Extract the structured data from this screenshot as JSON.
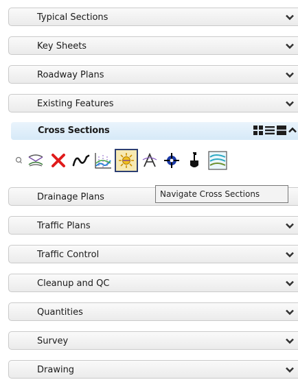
{
  "sections_before": [
    {
      "label": "Typical Sections"
    },
    {
      "label": "Key Sheets"
    },
    {
      "label": "Roadway Plans"
    },
    {
      "label": "Existing Features"
    }
  ],
  "active_section": {
    "label": "Cross Sections",
    "view_icons": [
      "grid-view-icon",
      "list-view-icon",
      "large-view-icon",
      "collapse-icon"
    ]
  },
  "toolbar": {
    "tools": [
      {
        "icon": "toolbar-grip-icon"
      },
      {
        "icon": "cross-section-template-icon"
      },
      {
        "icon": "delete-red-x-icon"
      },
      {
        "icon": "curve-profile-icon"
      },
      {
        "icon": "cross-section-chart-icon"
      },
      {
        "icon": "navigate-cross-sections-icon",
        "selected": true
      },
      {
        "icon": "annotate-cross-section-icon"
      },
      {
        "icon": "target-crosshair-icon"
      },
      {
        "icon": "shovel-icon"
      },
      {
        "icon": "cross-section-report-icon"
      }
    ],
    "tooltip": "Navigate Cross Sections"
  },
  "sections_after": [
    {
      "label": "Drainage Plans"
    },
    {
      "label": "Traffic Plans"
    },
    {
      "label": "Traffic Control"
    },
    {
      "label": "Cleanup and QC"
    },
    {
      "label": "Quantities"
    },
    {
      "label": "Survey"
    },
    {
      "label": "Drawing"
    }
  ],
  "colors": {
    "accent_header": "#d6e9f8",
    "selected_tool": "#f6e9b3",
    "delete_red": "#e01b1b"
  }
}
